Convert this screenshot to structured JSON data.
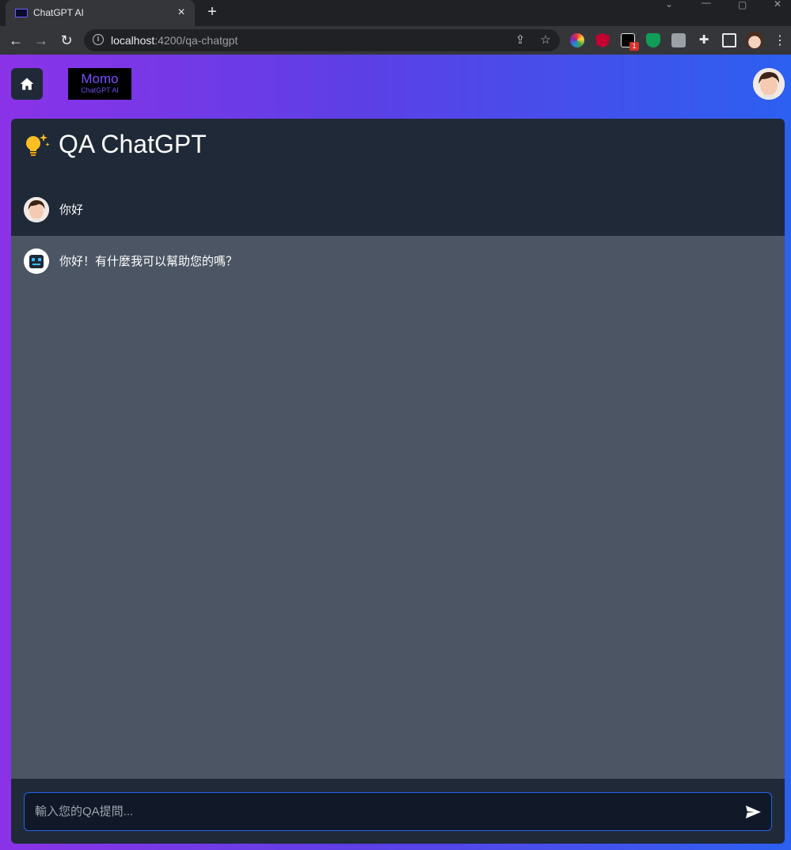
{
  "browser": {
    "tab_title": "ChatGPT AI",
    "url_host": "localhost",
    "url_path": ":4200/qa-chatgpt",
    "extension_badge": "1"
  },
  "app": {
    "logo_name": "Momo",
    "logo_sub": "ChatGPT AI"
  },
  "panel": {
    "title": "QA ChatGPT"
  },
  "messages": [
    {
      "role": "user",
      "text": "你好"
    },
    {
      "role": "assistant",
      "text": "你好！有什麼我可以幫助您的嗎？"
    }
  ],
  "input": {
    "placeholder": "輸入您的QA提問...",
    "value": ""
  },
  "colors": {
    "gradient_start": "#8b32e8",
    "gradient_end": "#2c60f0",
    "panel_dark": "#1f2937",
    "panel_body": "#4b5563",
    "input_border": "#2563eb"
  }
}
